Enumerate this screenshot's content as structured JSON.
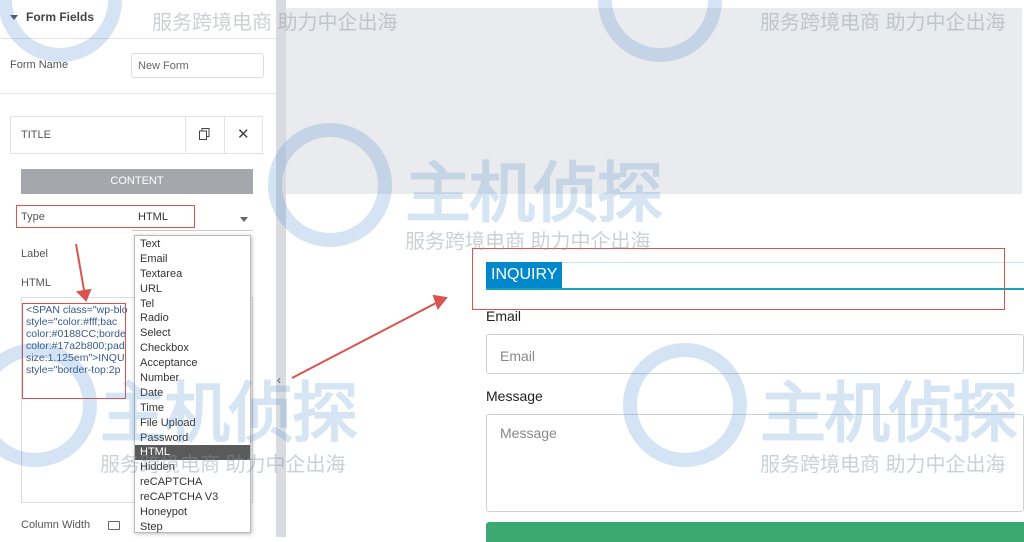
{
  "left_panel": {
    "section_title": "Form Fields",
    "form_name_label": "Form Name",
    "form_name_value": "New Form",
    "repeater_title": "TITLE",
    "content_tab": "CONTENT",
    "type_label": "Type",
    "type_value": "HTML",
    "label_label": "Label",
    "html_label": "HTML",
    "html_code": "<SPAN class=\"wp-blo\nstyle=\"color:#fff;bac\ncolor:#0188CC;borde\ncolor:#17a2b800;pad\nsize:1.125em\">INQU\nstyle=\"border-top:2p",
    "column_width_label": "Column Width",
    "type_options": [
      "Text",
      "Email",
      "Textarea",
      "URL",
      "Tel",
      "Radio",
      "Select",
      "Checkbox",
      "Acceptance",
      "Number",
      "Date",
      "Time",
      "File Upload",
      "Password",
      "HTML",
      "Hidden",
      "reCAPTCHA",
      "reCAPTCHA V3",
      "Honeypot",
      "Step"
    ],
    "selected_option": "HTML"
  },
  "preview": {
    "inquiry_title": "INQUIRY",
    "email_label": "Email",
    "email_placeholder": "Email",
    "message_label": "Message",
    "message_placeholder": "Message"
  },
  "watermarks": {
    "slogan": "服务跨境电商 助力中企出海",
    "logo_text": "主机侦探"
  },
  "colors": {
    "inquiry_bg": "#0188cc",
    "inquiry_border": "#17a2b8",
    "highlight_red": "#d9534f",
    "submit_green": "#3aaa72"
  }
}
